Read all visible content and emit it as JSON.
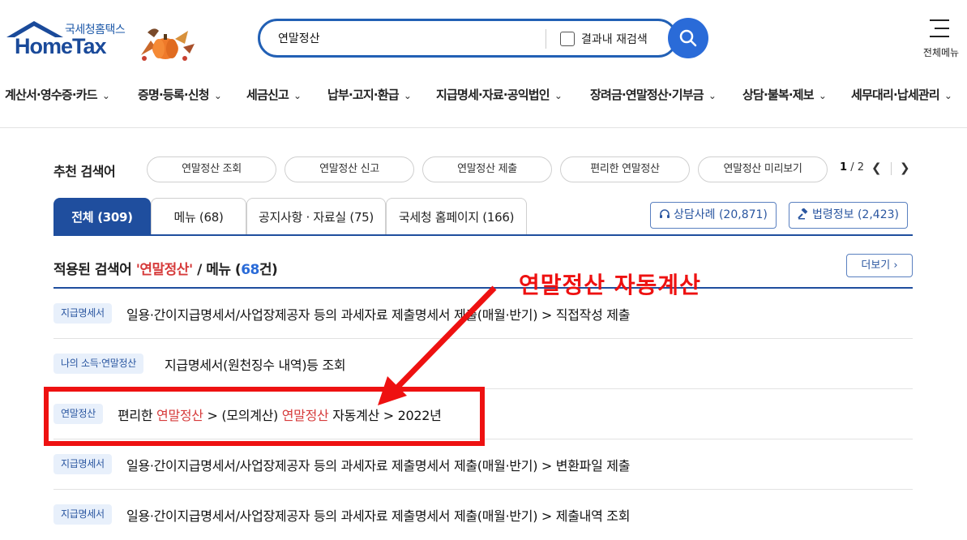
{
  "header": {
    "logo_small": "국세청홈택스",
    "logo_main": "HomeTax",
    "search_value": "연말정산",
    "search_checkbox_label": "결과내 재검색",
    "all_menu_label": "전체메뉴"
  },
  "gnb": [
    "계산서·영수증·카드",
    "증명·등록·신청",
    "세금신고",
    "납부·고지·환급",
    "지급명세·자료·공익법인",
    "장려금·연말정산·기부금",
    "상담·불복·제보",
    "세무대리·납세관리"
  ],
  "recommended": {
    "title": "추천 검색어",
    "items": [
      "연말정산 조회",
      "연말정산 신고",
      "연말정산 제출",
      "편리한 연말정산",
      "연말정산 미리보기"
    ],
    "page_current": "1",
    "page_total": "/ 2"
  },
  "tabs": [
    "전체 (309)",
    "메뉴 (68)",
    "공지사항 · 자료실 (75)",
    "국세청 홈페이지 (166)"
  ],
  "side_buttons": {
    "counsel": "상담사례 (20,871)",
    "law": "법령정보 (2,423)"
  },
  "results_header": {
    "prefix": "적용된 검색어 ",
    "keyword": "'연말정산'",
    "middle": " / 메뉴 (",
    "count": "68",
    "suffix": "건)",
    "more_label": "더보기"
  },
  "results": [
    {
      "tag": "지급명세서",
      "text": "일용·간이지급명세서/사업장제공자 등의 과세자료 제출명세서 제출(매월·반기) > 직접작성 제출"
    },
    {
      "tag": "나의 소득·연말정산",
      "text": "지급명세서(원천징수 내역)등 조회"
    },
    {
      "tag": "연말정산",
      "parts": [
        "편리한 ",
        "연말정산",
        " > (모의계산) ",
        "연말정산",
        " 자동계산 > 2022년"
      ]
    },
    {
      "tag": "지급명세서",
      "text": "일용·간이지급명세서/사업장제공자 등의 과세자료 제출명세서 제출(매월·반기) > 변환파일 제출"
    },
    {
      "tag": "지급명세서",
      "text": "일용·간이지급명세서/사업장제공자 등의 과세자료 제출명세서 제출(매월·반기) > 제출내역 조회"
    }
  ],
  "annotation": {
    "text": "연말정산 자동계산",
    "color": "#ee1111"
  },
  "colors": {
    "brand_blue": "#1f4e9e",
    "search_button": "#2a6bd8",
    "keyword_red": "#d63b3b",
    "tag_bg": "#e8f0fb"
  }
}
